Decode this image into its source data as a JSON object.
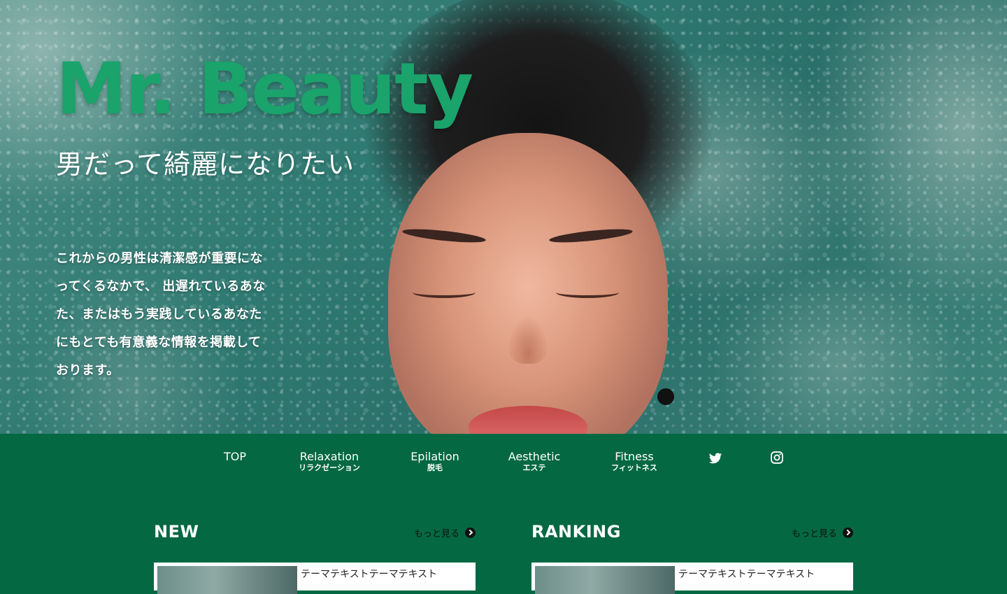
{
  "hero": {
    "title": "Mr. Beauty",
    "subtitle": "男だって綺麗になりたい",
    "description": "これからの男性は清潔感が重要になってくるなかで、 出遅れているあなた、またはもう実践しているあなた にもとても有意義な情報を掲載しております。"
  },
  "nav": {
    "items": [
      {
        "en": "TOP",
        "jp": ""
      },
      {
        "en": "Relaxation",
        "jp": "リラクゼーション"
      },
      {
        "en": "Epilation",
        "jp": "脱毛"
      },
      {
        "en": "Aesthetic",
        "jp": "エステ"
      },
      {
        "en": "Fitness",
        "jp": "フィットネス"
      }
    ],
    "icons": [
      "twitter-icon",
      "instagram-icon"
    ]
  },
  "sections": {
    "new": {
      "title": "NEW",
      "more": "もっと見る",
      "card_text": "テーマテキストテーマテキスト"
    },
    "ranking": {
      "title": "RANKING",
      "more": "もっと見る",
      "card_text": "テーマテキストテーマテキスト"
    }
  },
  "colors": {
    "brand_green": "#1aa36b",
    "nav_background": "#046843",
    "text_white": "#ffffff"
  }
}
